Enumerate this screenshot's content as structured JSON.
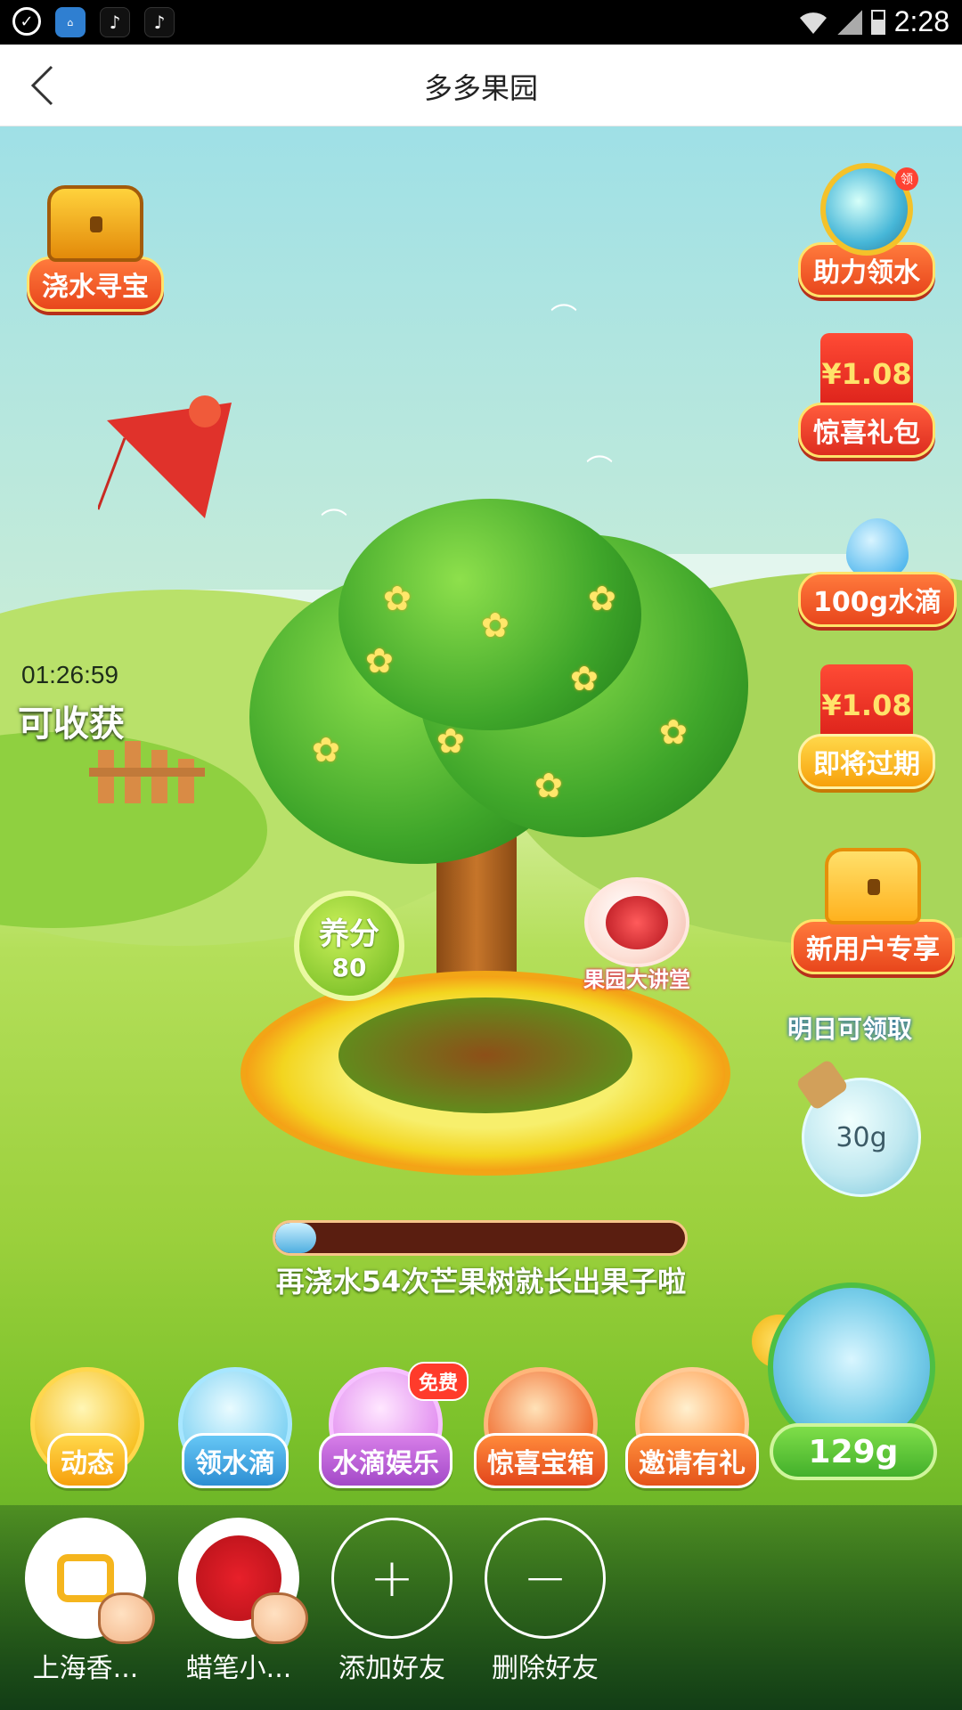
{
  "header": {
    "title": "多多果园"
  },
  "side_left": {
    "treasure_label": "浇水寻宝"
  },
  "side_right": {
    "help_label": "助力领水",
    "help_badge": "领",
    "gift_amount": "¥1.08",
    "gift_label": "惊喜礼包",
    "water_label": "100g水滴",
    "expire_amount": "¥1.08",
    "expire_label": "即将过期",
    "newuser_label": "新用户专享",
    "tomorrow_label": "明日可领取",
    "jar_amount": "30g"
  },
  "harvest": {
    "timer": "01:26:59",
    "label": "可收获"
  },
  "tree": {
    "score_label": "养分",
    "score_value": "80",
    "lecture_label": "果园大讲堂",
    "progress_fraction": 0.1,
    "progress_text": "再浇水54次芒果树就长出果子啦"
  },
  "kettle": {
    "amount": "129g"
  },
  "bottom_nav": [
    {
      "label": "动态"
    },
    {
      "label": "领水滴"
    },
    {
      "label": "水滴娱乐",
      "badge": "免费"
    },
    {
      "label": "惊喜宝箱"
    },
    {
      "label": "邀请有礼"
    }
  ],
  "friends": [
    {
      "name": "上海香..."
    },
    {
      "name": "蜡笔小..."
    },
    {
      "name": "添加好友"
    },
    {
      "name": "删除好友"
    }
  ],
  "status_bar": {
    "time": "2:28"
  }
}
